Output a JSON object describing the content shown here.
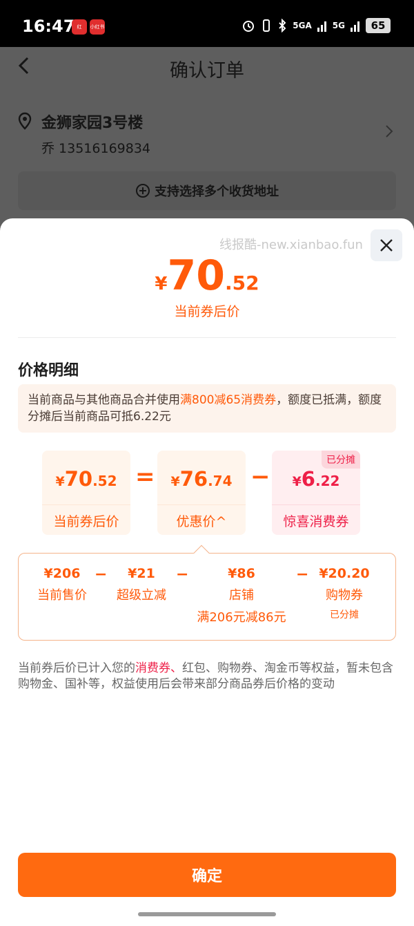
{
  "status_bar": {
    "time": "16:47",
    "app_icon_1": "红",
    "app_icon_2": "小红书",
    "signal_1": "5GA",
    "signal_2": "5G",
    "battery": "65"
  },
  "page": {
    "title": "确认订单",
    "address_name": "金狮家园3号楼",
    "address_contact": "乔 13516169834",
    "multi_address_label": "支持选择多个收货地址"
  },
  "sheet": {
    "watermark": "线报酷-new.xianbao.fun",
    "price_currency": "¥",
    "price_int": "70",
    "price_dec": ".52",
    "price_label": "当前券后价",
    "section_title": "价格明细",
    "notice": {
      "part1": "当前商品与其他商品合并使用",
      "highlight": "满800减65消费券",
      "part2": "，额度已抵满，额度分摊后当前商品可抵6.22元"
    },
    "equation": {
      "card1": {
        "cur": "¥",
        "int": "70",
        "dec": ".52",
        "label": "当前券后价"
      },
      "op1": "=",
      "card2": {
        "cur": "¥",
        "int": "76",
        "dec": ".74",
        "label": "优惠价^"
      },
      "op2": "−",
      "card3": {
        "cur": "¥",
        "int": "6",
        "dec": ".22",
        "label": "惊喜消费券",
        "tag": "已分摊"
      }
    },
    "breakdown": {
      "item1": {
        "value": "¥206",
        "label": "当前售价"
      },
      "op1": "−",
      "item2": {
        "value": "¥21",
        "label": "超级立减"
      },
      "op2": "−",
      "item3": {
        "value": "¥86",
        "label": "店铺",
        "sub": "满206元减86元"
      },
      "op3": "−",
      "item4": {
        "value": "¥20.20",
        "label": "购物券",
        "sub": "已分摊"
      }
    },
    "footnote": {
      "part1": "当前券后价已计入您的",
      "highlight": "消费券、",
      "part2": "红包、购物券、淘金币等权益，暂未包含购物金、国补等，权益使用后会带来部分商品券后价格的变动"
    },
    "confirm_label": "确定"
  },
  "colors": {
    "accent": "#ff5a0a",
    "coupon_red": "#ee1f47",
    "confirm_button": "#ff6a10"
  }
}
